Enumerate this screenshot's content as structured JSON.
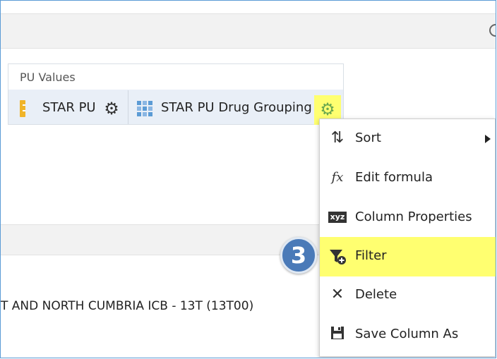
{
  "pivot": {
    "header_label": "PU Values",
    "measures": [
      {
        "label": "STAR PU",
        "icon": "ruler-icon",
        "options_icon": "gear-icon"
      },
      {
        "label": "STAR PU Drug Grouping",
        "icon": "grid-icon",
        "options_icon": "gear-icon",
        "options_color": "#6aa84f"
      }
    ]
  },
  "table": {
    "row_text": "T AND NORTH CUMBRIA ICB - 13T (13T00)"
  },
  "context_menu": {
    "items": [
      {
        "label": "Sort",
        "icon": "sort-icon",
        "has_submenu": true
      },
      {
        "label": "Edit formula",
        "icon": "fx-icon"
      },
      {
        "label": "Column Properties",
        "icon": "xyz-icon"
      },
      {
        "label": "Filter",
        "icon": "filter-add-icon",
        "highlighted": true
      },
      {
        "label": "Delete",
        "icon": "close-icon"
      },
      {
        "label": "Save Column As",
        "icon": "save-icon"
      }
    ]
  },
  "step_badge": {
    "number": "3",
    "color": "#4a7ab8"
  },
  "highlight_color": "#ffff70"
}
